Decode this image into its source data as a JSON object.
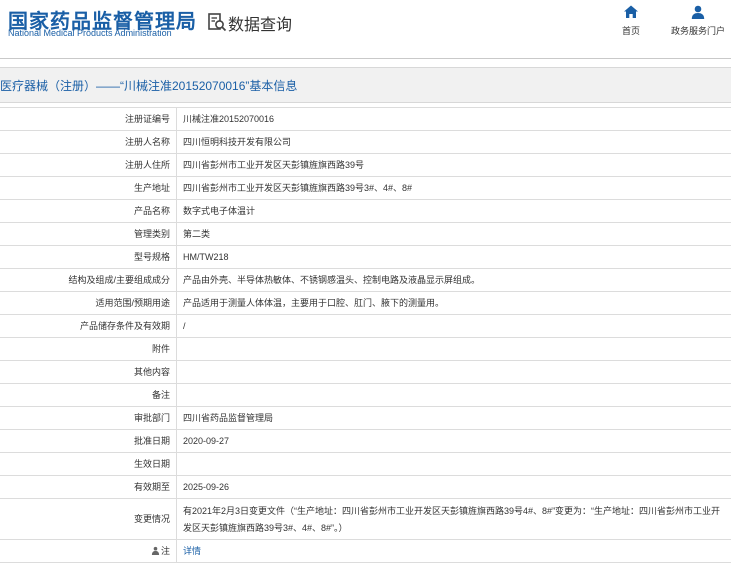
{
  "header": {
    "logo_cn": "国家药品监督管理局",
    "logo_en": "National Medical Products Administration",
    "query_title": "数据查询",
    "query_icon": "data-query-icon",
    "nav": [
      {
        "label": "首页",
        "icon": "home-icon"
      },
      {
        "label": "政务服务门户",
        "icon": "user-icon"
      }
    ],
    "brand_color": "#1a5fa6"
  },
  "page_title": "医疗器械（注册）——“川械注准20152070016”基本信息",
  "rows": [
    {
      "label": "注册证编号",
      "value": "川械注准20152070016"
    },
    {
      "label": "注册人名称",
      "value": "四川恒明科技开发有限公司"
    },
    {
      "label": "注册人住所",
      "value": "四川省彭州市工业开发区天彭镇旌旗西路39号"
    },
    {
      "label": "生产地址",
      "value": "四川省彭州市工业开发区天彭镇旌旗西路39号3#、4#、8#"
    },
    {
      "label": "产品名称",
      "value": "数字式电子体温计"
    },
    {
      "label": "管理类别",
      "value": "第二类"
    },
    {
      "label": "型号规格",
      "value": "HM/TW218"
    },
    {
      "label": "结构及组成/主要组成成分",
      "value": "产品由外壳、半导体热敏体、不锈钢感温头、控制电路及液晶显示屏组成。"
    },
    {
      "label": "适用范围/预期用途",
      "value": "产品适用于测量人体体温，主要用于口腔、肛门、腋下的测量用。"
    },
    {
      "label": "产品储存条件及有效期",
      "value": "/"
    },
    {
      "label": "附件",
      "value": ""
    },
    {
      "label": "其他内容",
      "value": ""
    },
    {
      "label": "备注",
      "value": ""
    },
    {
      "label": "审批部门",
      "value": "四川省药品监督管理局"
    },
    {
      "label": "批准日期",
      "value": "2020-09-27"
    },
    {
      "label": "生效日期",
      "value": ""
    },
    {
      "label": "有效期至",
      "value": "2025-09-26"
    },
    {
      "label": "变更情况",
      "value": "有2021年2月3日变更文件（“生产地址：四川省彭州市工业开发区天彭镇旌旗西路39号4#、8#”变更为：“生产地址：四川省彭州市工业开发区天彭镇旌旗西路39号3#、4#、8#”。）"
    },
    {
      "label": "注",
      "label_icon": "note-icon",
      "value": "详情"
    }
  ]
}
